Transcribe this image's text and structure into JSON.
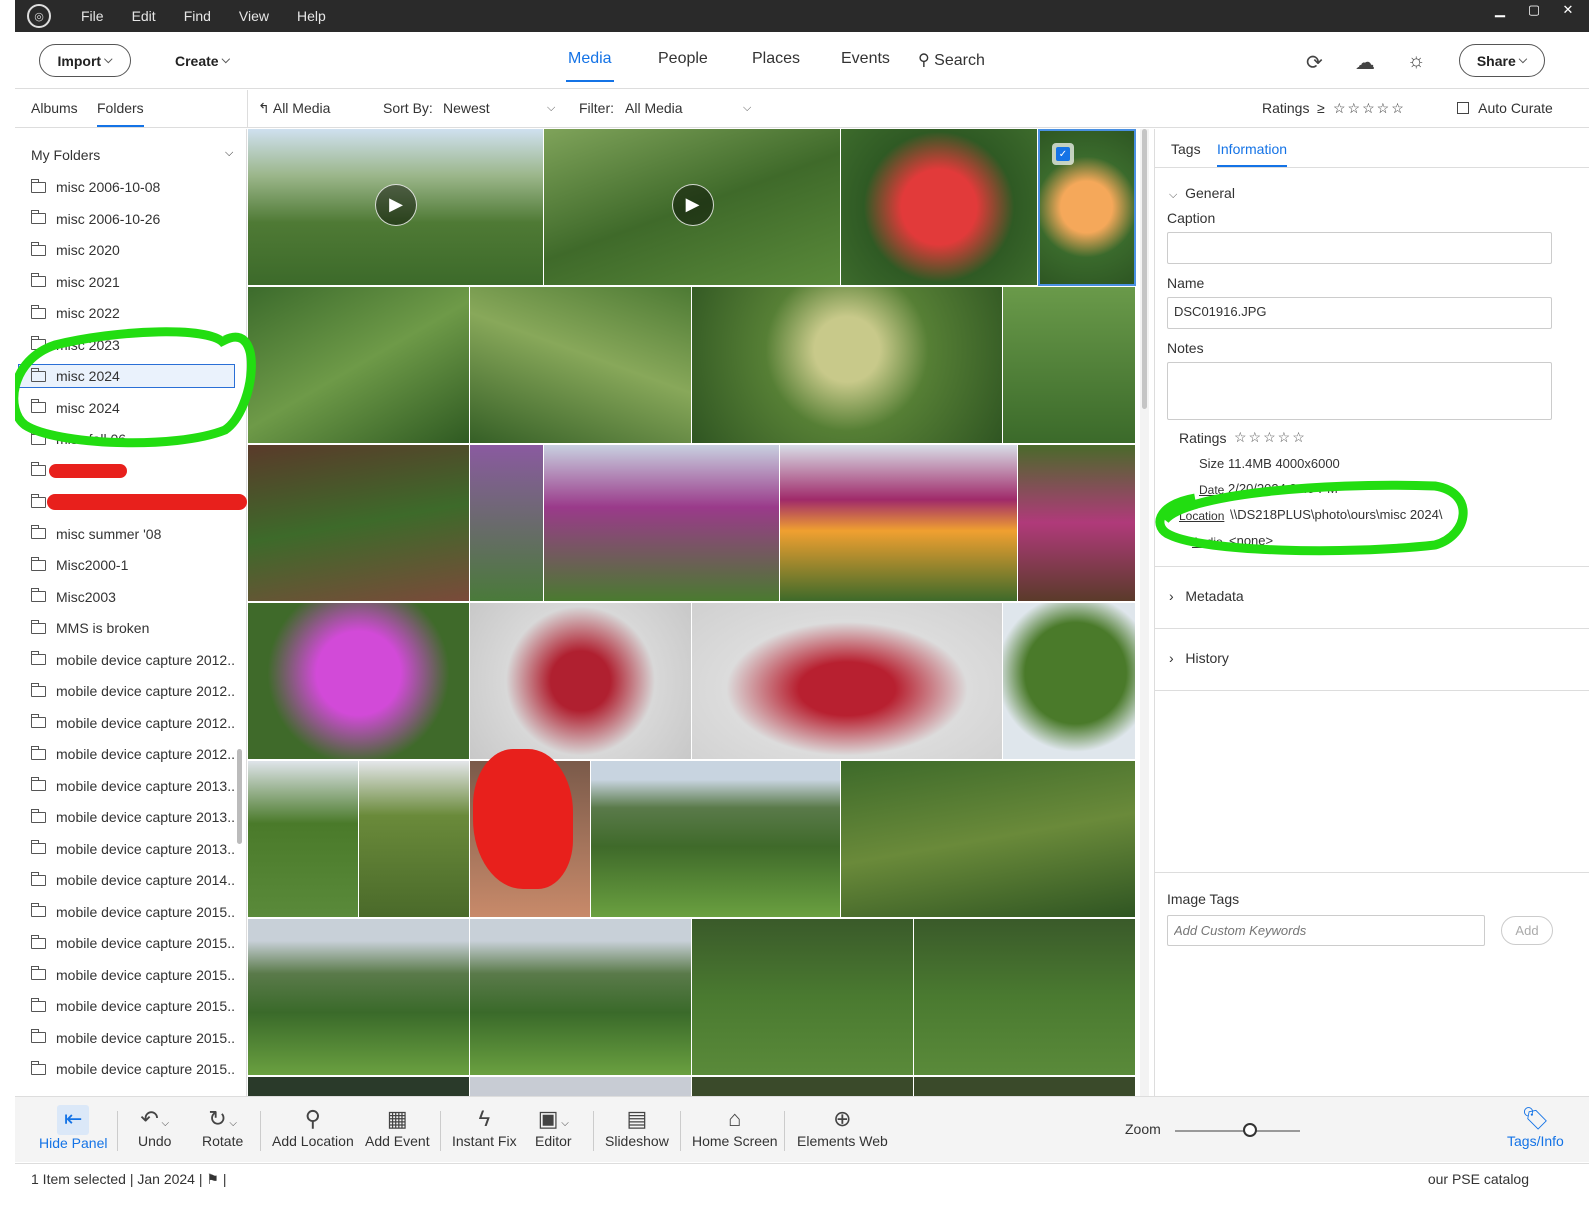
{
  "titlebar": {
    "menu": [
      "File",
      "Edit",
      "Find",
      "View",
      "Help"
    ],
    "minimize": "▁",
    "maximize": "▢",
    "close": "✕"
  },
  "topnav": {
    "import_label": "Import",
    "create_label": "Create",
    "tabs": [
      "Media",
      "People",
      "Places",
      "Events"
    ],
    "search_label": "Search",
    "share_label": "Share",
    "icons": [
      "sync-icon",
      "cloud-icon",
      "brightness-icon"
    ]
  },
  "subbar": {
    "albums_tab": "Albums",
    "folders_tab": "Folders",
    "all_media": "All Media",
    "sort_by_label": "Sort By:",
    "sort_by_value": "Newest",
    "filter_label": "Filter:",
    "filter_value": "All Media",
    "ratings_label": "Ratings",
    "ratings_op": "≥",
    "ratings_stars": "☆☆☆☆☆",
    "auto_curate": "Auto Curate"
  },
  "leftpanel": {
    "header": "My Folders",
    "folders": [
      "misc 2006-10-08",
      "misc 2006-10-26",
      "misc 2020",
      "misc 2021",
      "misc 2022",
      "misc 2023",
      "misc 2024",
      "misc 2024",
      "misc fall 06",
      "",
      "",
      "misc summer '08",
      "Misc2000-1",
      "Misc2003",
      "MMS is broken",
      "mobile device capture 2012..",
      "mobile device capture 2012..",
      "mobile device capture 2012..",
      "mobile device capture 2012..",
      "mobile device capture 2013..",
      "mobile device capture 2013..",
      "mobile device capture 2013..",
      "mobile device capture 2014..",
      "mobile device capture 2015..",
      "mobile device capture 2015..",
      "mobile device capture 2015..",
      "mobile device capture 2015..",
      "mobile device capture 2015..",
      "mobile device capture 2015.."
    ],
    "selected_index": 6
  },
  "rightpanel": {
    "tabs": [
      "Tags",
      "Information"
    ],
    "general_label": "General",
    "caption_label": "Caption",
    "caption_value": "",
    "name_label": "Name",
    "name_value": "DSC01916.JPG",
    "notes_label": "Notes",
    "notes_value": "",
    "ratings_label": "Ratings",
    "ratings_stars": "☆☆☆☆☆",
    "size_label": "Size",
    "size_value": "11.4MB  4000x6000",
    "date_label": "Date",
    "date_value": "2/20/2024 2:49 PM",
    "location_label": "Location",
    "location_value": "\\\\DS218PLUS\\photo\\ours\\misc 2024\\",
    "audio_label": "Audio",
    "audio_value": "<none>",
    "metadata_label": "Metadata",
    "history_label": "History",
    "image_tags_label": "Image Tags",
    "keywords_placeholder": "Add Custom Keywords",
    "add_label": "Add"
  },
  "toolbar": {
    "hide_panel": "Hide Panel",
    "undo": "Undo",
    "rotate": "Rotate",
    "add_location": "Add Location",
    "add_event": "Add Event",
    "instant_fix": "Instant Fix",
    "editor": "Editor",
    "slideshow": "Slideshow",
    "home_screen": "Home Screen",
    "elements_web": "Elements Web",
    "zoom_label": "Zoom",
    "tags_info": "Tags/Info"
  },
  "statusbar": {
    "text": "1 Item selected | Jan 2024  |",
    "catalog": "our PSE catalog"
  },
  "colors": {
    "accent": "#1473e6",
    "annotation_green": "#22dd11",
    "annotation_red": "#e8201c"
  }
}
